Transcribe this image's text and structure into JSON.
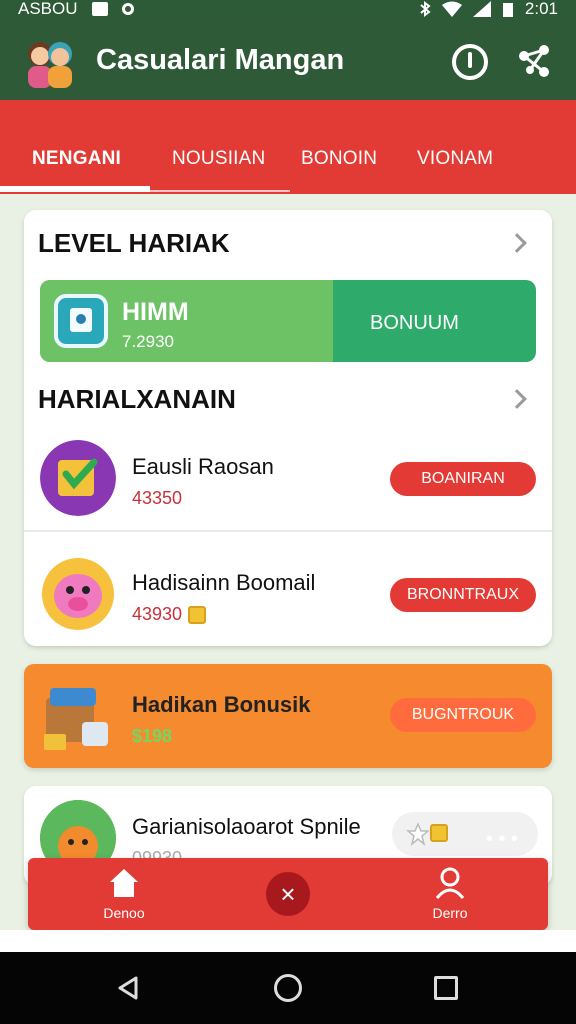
{
  "status_bar": {
    "carrier": "ASBOU",
    "time": "2:01"
  },
  "app": {
    "title": "Casualari Mangan"
  },
  "tabs": [
    {
      "label": "NENGANI",
      "active": true
    },
    {
      "label": "NOUSIIAN",
      "active": false
    },
    {
      "label": "BONOIN",
      "active": false
    },
    {
      "label": "VIONAM",
      "active": false
    }
  ],
  "level": {
    "section_title": "LEVEL HARIAK",
    "name": "HIMM",
    "value": "7.2930",
    "button": "BONUUM",
    "progress_fraction": 0.59
  },
  "daily": {
    "section_title": "HARIALXANAIN",
    "items": [
      {
        "title": "Eausli Raosan",
        "value": "43350",
        "button": "BOANIRAN"
      },
      {
        "title": "Hadisainn Boomail",
        "value": "43930",
        "button": "BRONNTRAUX"
      }
    ]
  },
  "featured": {
    "title": "Hadikan Bonusik",
    "value": "$198",
    "button": "BUGNTROUK"
  },
  "partial": {
    "title": "Garianisolaoarot Spnile",
    "value": "09930"
  },
  "bottom_nav": [
    {
      "label": "Denoo"
    },
    {
      "label": "Derro"
    }
  ],
  "colors": {
    "green_dark": "#2f5a37",
    "red": "#e23b35",
    "orange": "#f58a2f",
    "green_progress": "#2eaa6a"
  },
  "icons": [
    "wifi-icon",
    "signal-icon",
    "battery-icon",
    "power-icon",
    "share-icon",
    "home-icon",
    "close-icon",
    "user-icon"
  ]
}
